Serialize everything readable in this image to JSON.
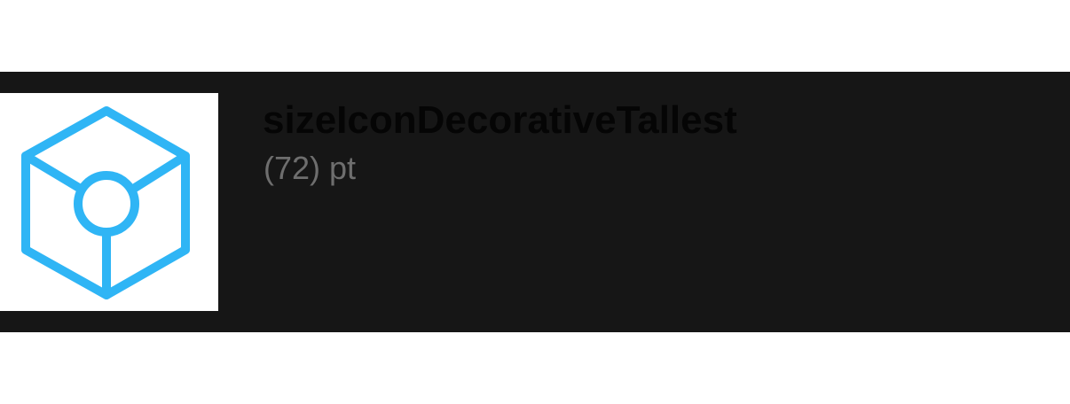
{
  "token": {
    "name": "sizeIconDecorativeTallest",
    "value": "(72) pt"
  },
  "icon": {
    "semantic": "cube-icon",
    "color": "#2FB5F5"
  },
  "colors": {
    "row_background": "#161616",
    "swatch_background": "#FFFFFF",
    "name_text": "#050505",
    "value_text": "#6E6E6E"
  }
}
